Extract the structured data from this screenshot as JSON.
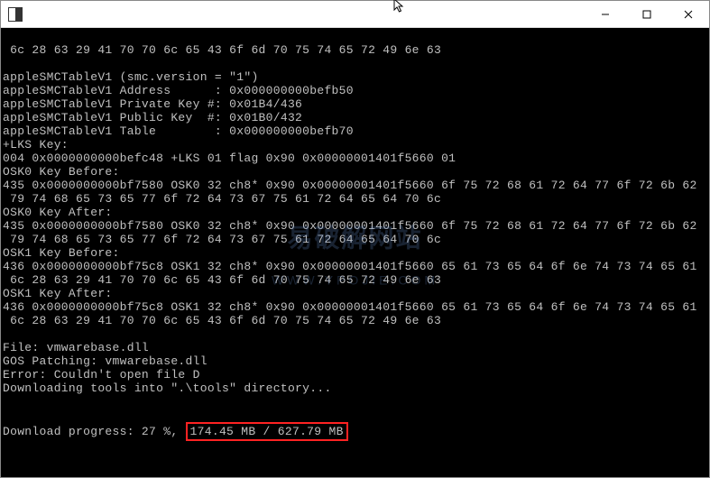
{
  "title": "",
  "terminal": {
    "hexline1": " 6c 28 63 29 41 70 70 6c 65 43 6f 6d 70 75 74 65 72 49 6e 63",
    "smc_version": "appleSMCTableV1 (smc.version = \"1\")",
    "smc_address": "appleSMCTableV1 Address      : 0x000000000befb50",
    "smc_privatekey": "appleSMCTableV1 Private Key #: 0x01B4/436",
    "smc_publickey": "appleSMCTableV1 Public Key  #: 0x01B0/432",
    "smc_table": "appleSMCTableV1 Table        : 0x000000000befb70",
    "lks_key": "+LKS Key:",
    "lks_line": "004 0x0000000000befc48 +LKS 01 flag 0x90 0x00000001401f5660 01",
    "osk0_before": "OSK0 Key Before:",
    "osk0_before_l1": "435 0x0000000000bf7580 OSK0 32 ch8* 0x90 0x00000001401f5660 6f 75 72 68 61 72 64 77 6f 72 6b 62",
    "osk0_before_l2": " 79 74 68 65 73 65 77 6f 72 64 73 67 75 61 72 64 65 64 70 6c",
    "osk0_after": "OSK0 Key After:",
    "osk0_after_l1": "435 0x0000000000bf7580 OSK0 32 ch8* 0x90 0x00000001401f5660 6f 75 72 68 61 72 64 77 6f 72 6b 62",
    "osk0_after_l2": " 79 74 68 65 73 65 77 6f 72 64 73 67 75 61 72 64 65 64 70 6c",
    "osk1_before": "OSK1 Key Before:",
    "osk1_before_l1": "436 0x0000000000bf75c8 OSK1 32 ch8* 0x90 0x00000001401f5660 65 61 73 65 64 6f 6e 74 73 74 65 61",
    "osk1_before_l2": " 6c 28 63 29 41 70 70 6c 65 43 6f 6d 70 75 74 65 72 49 6e 63",
    "osk1_after": "OSK1 Key After:",
    "osk1_after_l1": "436 0x0000000000bf75c8 OSK1 32 ch8* 0x90 0x00000001401f5660 65 61 73 65 64 6f 6e 74 73 74 65 61",
    "osk1_after_l2": " 6c 28 63 29 41 70 70 6c 65 43 6f 6d 70 75 74 65 72 49 6e 63",
    "file_line": "File: vmwarebase.dll",
    "gos_line": "GOS Patching: vmwarebase.dll",
    "error_line": "Error: Couldn't open file D",
    "download_tools": "Downloading tools into \".\\tools\" directory...",
    "progress_prefix": "Download progress: 27 %, ",
    "progress_highlight": "174.45 MB / 627.79 MB"
  },
  "watermark": {
    "line1": "易破解网站",
    "line2": "WWW.YPOJIE.COM"
  }
}
